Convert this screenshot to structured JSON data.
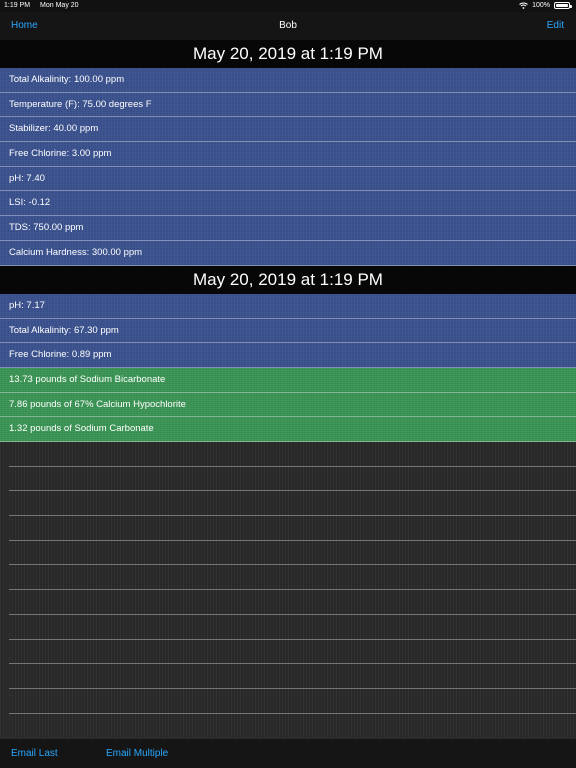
{
  "status_bar": {
    "time": "1:19 PM",
    "date": "Mon May 20",
    "battery": "100%"
  },
  "nav": {
    "back_label": "Home",
    "title": "Bob",
    "edit_label": "Edit"
  },
  "sections": [
    {
      "header": "May 20, 2019 at 1:19 PM",
      "rows": [
        "Total Alkalinity: 100.00 ppm",
        "Temperature (F): 75.00 degrees F",
        "Stabilizer: 40.00 ppm",
        "Free Chlorine: 3.00 ppm",
        "pH: 7.40",
        "LSI: -0.12",
        "TDS: 750.00 ppm",
        "Calcium Hardness: 300.00 ppm"
      ]
    },
    {
      "header": "May 20, 2019 at 1:19 PM",
      "rows": [
        "pH: 7.17",
        "Total Alkalinity: 67.30 ppm",
        "Free Chlorine: 0.89 ppm"
      ],
      "recommendations": [
        "13.73 pounds of Sodium Bicarbonate",
        "7.86 pounds of 67% Calcium Hypochlorite",
        "1.32 pounds of Sodium Carbonate"
      ]
    }
  ],
  "toolbar": {
    "email_last": "Email Last",
    "email_multiple": "Email Multiple"
  },
  "colors": {
    "reading_row": "#3c5390",
    "recommendation_row": "#3c9656",
    "accent": "#2aa8ff"
  }
}
